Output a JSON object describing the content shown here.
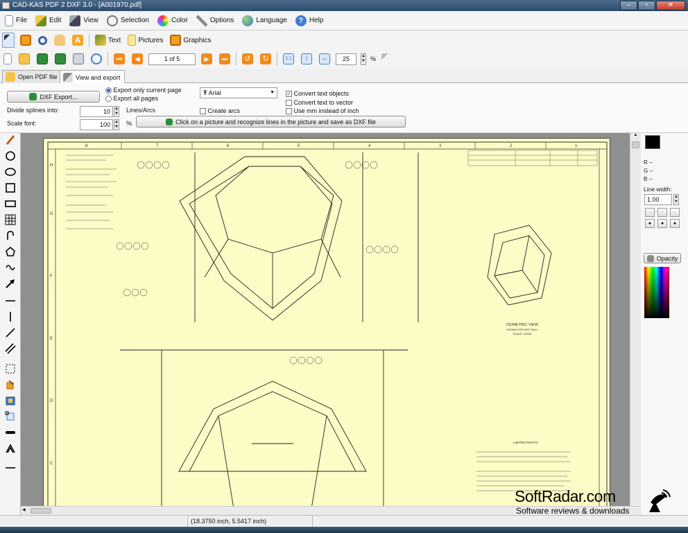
{
  "window": {
    "title": "CAD-KAS PDF 2 DXF 3.0 - [A001970.pdf]",
    "minimize": "–",
    "maximize": "▫",
    "close": "✕"
  },
  "menu": [
    {
      "label": "File",
      "icon": "file-icon"
    },
    {
      "label": "Edit",
      "icon": "pencil-icon"
    },
    {
      "label": "View",
      "icon": "view-icon"
    },
    {
      "label": "Selection",
      "icon": "lasso-icon"
    },
    {
      "label": "Color",
      "icon": "palette-icon"
    },
    {
      "label": "Options",
      "icon": "wrench-icon"
    },
    {
      "label": "Language",
      "icon": "globe-icon"
    },
    {
      "label": "Help",
      "icon": "help-icon"
    }
  ],
  "toolbar1": {
    "text_label": "Text",
    "pictures_label": "Pictures",
    "graphics_label": "Graphics"
  },
  "toolbar2": {
    "page_value": "1 of 5",
    "zoom_value": "25",
    "zoom_unit": "%"
  },
  "tabs": {
    "open_pdf": "Open PDF file",
    "view_export": "View and export"
  },
  "options": {
    "dxf_export": "DXF Export...",
    "export_current": "Export only current page",
    "export_all": "Export all pages",
    "font_name": "Arial",
    "convert_text_objects": "Convert text objects",
    "convert_text_vector": "Convert text to vector",
    "use_mm": "Use mm instead of inch",
    "divide_label": "Divide splines into:",
    "divide_value": "10",
    "lines_arcs": "Lines/Arcs",
    "create_arcs": "Create arcs",
    "scale_label": "Scale font:",
    "scale_value": "100",
    "scale_unit": "%",
    "recognize": "Click on a picture and recognize lines in the picture and save as DXF file"
  },
  "drawing": {
    "col_numbers": [
      "8",
      "7",
      "6",
      "5",
      "4",
      "3",
      "2",
      "1"
    ],
    "row_letters": [
      "H",
      "G",
      "F",
      "E",
      "D",
      "C"
    ],
    "iso_title": "ISOMETRIC VIEW",
    "iso_sub1": "SHOWN FOR REF ONLY",
    "iso_sub2": "SCALE: NONE",
    "rights_title": "LIMITED RIGHTS"
  },
  "right_panel": {
    "r_label": "R --",
    "g_label": "G --",
    "b_label": "B --",
    "line_width_label": "Line width:",
    "line_width_value": "1.00",
    "opacity": "Opacity"
  },
  "status": {
    "coords": "(18.3750 inch, 5.5417 inch)"
  },
  "watermark": {
    "brand": "SoftRadar.com",
    "tagline": "Software reviews & downloads"
  },
  "colors": {
    "sheet": "#fdfbc6",
    "primary_color": "#000000",
    "secondary_color": "#ffff00"
  }
}
